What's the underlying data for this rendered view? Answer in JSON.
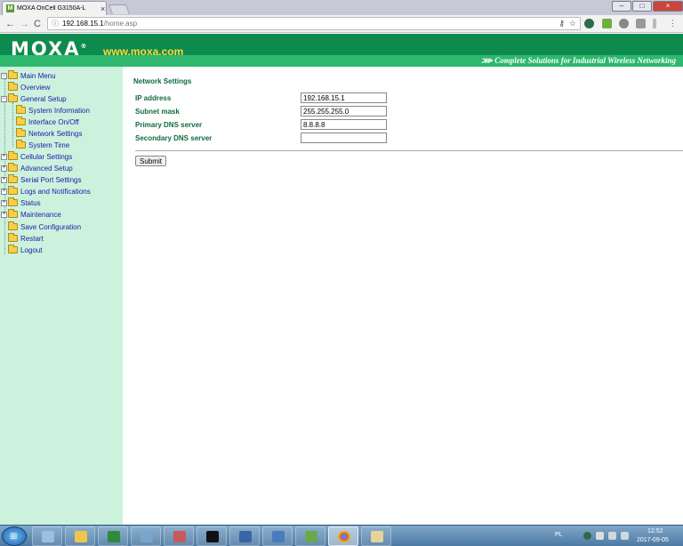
{
  "browser": {
    "tab_title": "MOXA OnCell G3150A-L",
    "tab_close": "×",
    "favicon_text": "M",
    "url_host": "192.168.15.1",
    "url_path": "/home.asp",
    "nav_back": "←",
    "nav_forward": "→",
    "nav_reload": "C",
    "info_icon": "ⓘ",
    "key_icon": "⚷",
    "star_icon": "☆",
    "win_minimize": "–",
    "win_maximize": "□",
    "win_close": "×"
  },
  "header": {
    "logo": "MOXA",
    "logo_mark": "®",
    "site_url": "www.moxa.com",
    "slogan": "⋙ Complete Solutions for Industrial Wireless Networking"
  },
  "sidebar": {
    "root": "Main Menu",
    "items": [
      {
        "label": "Overview",
        "expander": ""
      },
      {
        "label": "General Setup",
        "expander": "−"
      },
      {
        "label": "System Information",
        "expander": ""
      },
      {
        "label": "Interface On/Off",
        "expander": ""
      },
      {
        "label": "Network Settings",
        "expander": ""
      },
      {
        "label": "System Time",
        "expander": ""
      },
      {
        "label": "Cellular Settings",
        "expander": "+"
      },
      {
        "label": "Advanced Setup",
        "expander": "+"
      },
      {
        "label": "Serial Port Settings",
        "expander": "+"
      },
      {
        "label": "Logs and Notifications",
        "expander": "+"
      },
      {
        "label": "Status",
        "expander": "+"
      },
      {
        "label": "Maintenance",
        "expander": "+"
      },
      {
        "label": "Save Configuration",
        "expander": ""
      },
      {
        "label": "Restart",
        "expander": ""
      },
      {
        "label": "Logout",
        "expander": ""
      }
    ]
  },
  "main": {
    "title": "Network Settings",
    "fields": [
      {
        "label": "IP address",
        "value": "192.168.15.1"
      },
      {
        "label": "Subnet mask",
        "value": "255.255.255.0"
      },
      {
        "label": "Primary DNS server",
        "value": "8.8.8.8"
      },
      {
        "label": "Secondary DNS server",
        "value": ""
      }
    ],
    "submit_label": "Submit"
  },
  "taskbar": {
    "language": "PL",
    "time": "12:52",
    "date": "2017-09-05",
    "start_glyph": "⊞"
  },
  "colors": {
    "header_green": "#0e8a4e",
    "slogan_green": "#2db86e",
    "sidebar_bg": "#ccf2dd",
    "label_green": "#0e6b3e",
    "link_blue": "#1a1aa8",
    "url_yellow": "#ffd93a"
  }
}
